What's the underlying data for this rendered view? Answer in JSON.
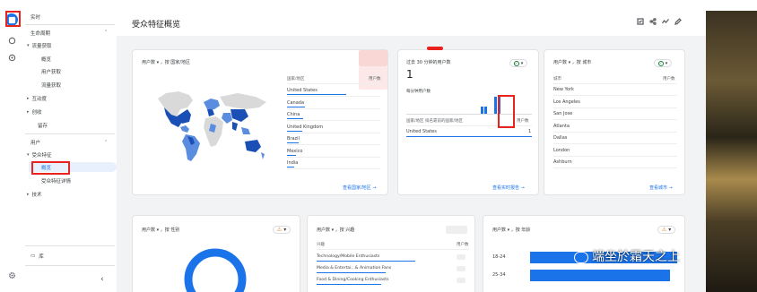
{
  "rail": {
    "icons": [
      "reports-icon",
      "explore-icon",
      "advertising-icon"
    ],
    "settings_icon": "gear-icon"
  },
  "sidebar": {
    "realtime": "实时",
    "lifecycle": "生命周期",
    "acquisition": "流量获取",
    "acq_overview": "概览",
    "user_acq": "用户获取",
    "traffic_acq": "流量获取",
    "engagement": "互动度",
    "monetization": "创收",
    "retention": "留存",
    "user": "用户",
    "demographics": "受众特征",
    "demo_overview": "概览",
    "demo_details": "受众特征详情",
    "tech": "技术",
    "library": "库",
    "collapse": "‹"
  },
  "page": {
    "title": "受众特征概览"
  },
  "country_card": {
    "title": "用户数 ▾ ，按 国家/地区",
    "col_country": "国家/地区",
    "col_users": "用户数",
    "rows": [
      "United States",
      "Canada",
      "China",
      "United Kingdom",
      "Brazil",
      "Mexico",
      "India"
    ],
    "row_bars": [
      1.0,
      0.3,
      0.28,
      0.25,
      0.2,
      0.15,
      0.12
    ],
    "link": "查看国家/地区 →"
  },
  "realtime_card": {
    "title": "过去 30 分钟的用户数",
    "value": "1",
    "subtitle": "每分钟用户数",
    "table_h1": "国家/地区 排名靠前的国家/地区",
    "table_h2": "用户数",
    "row_country": "United States",
    "row_value": "1",
    "link": "查看实时报告 →",
    "minute_bars": [
      0.4,
      0.4,
      0.95,
      0.95
    ]
  },
  "city_card": {
    "title": "用户数 ▾ ，按 城市",
    "col_city": "城市",
    "col_users": "用户数",
    "rows": [
      "New York",
      "Los Angeles",
      "San Jose",
      "Atlanta",
      "Dallas",
      "London",
      "Ashburn"
    ],
    "link": "查看城市 →"
  },
  "gender_card": {
    "title": "用户数 ▾ ，按 性别"
  },
  "interest_card": {
    "title": "用户数 ▾ ，按 兴趣",
    "col_interest": "兴趣",
    "col_users": "用户数",
    "rows": [
      "Technology/Mobile Enthusiasts",
      "Media & Entertai...& Animation Fans",
      "Food & Dining/Cooking Enthusiasts"
    ],
    "row_bars": [
      1.0,
      0.7,
      0.65
    ]
  },
  "age_card": {
    "title": "用户数 ▾ ，按 年龄",
    "rows": [
      "18-24",
      "25-34"
    ],
    "row_bars": [
      1.0,
      0.95
    ]
  },
  "watermark": "端坐於霜天之上",
  "colors": {
    "accent": "#1a73e8",
    "highlight_red": "#e8231d"
  }
}
